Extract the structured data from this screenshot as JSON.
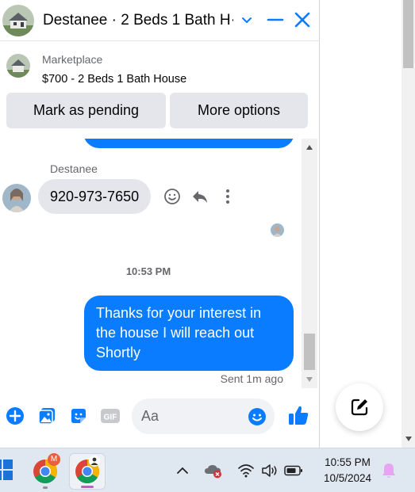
{
  "header": {
    "title": "Destanee · 2 Beds 1 Bath H···"
  },
  "marketplace": {
    "label": "Marketplace",
    "listing_title": "$700 - 2 Beds 1 Bath House",
    "mark_pending_label": "Mark as pending",
    "more_options_label": "More options"
  },
  "conversation": {
    "sender_name": "Destanee",
    "incoming_message": "920-973-7650",
    "timestamp": "10:53 PM",
    "outgoing_message": "Thanks for your interest in the house I will reach out Shortly",
    "sent_status": "Sent 1m ago"
  },
  "composer": {
    "placeholder": "Aa",
    "gif_label": "GIF"
  },
  "taskbar": {
    "gmail_badge": "M",
    "time": "10:55 PM",
    "date": "10/5/2024"
  },
  "colors": {
    "messenger_blue": "#0a7cff",
    "bubble_gray": "#e4e6eb",
    "taskbar_bg": "#dfe7f1"
  },
  "icons": {
    "header": [
      "house-avatar-icon",
      "chevron-down-icon",
      "minimize-icon",
      "close-icon"
    ],
    "message_actions": [
      "react-emoji-icon",
      "reply-icon",
      "more-vertical-icon"
    ],
    "composer": [
      "plus-circle-icon",
      "gallery-icon",
      "sticker-icon",
      "gif-icon",
      "emoji-icon",
      "thumbs-up-icon"
    ],
    "tray": [
      "chevron-up-icon",
      "onedrive-error-icon",
      "wifi-icon",
      "volume-icon",
      "battery-icon",
      "notification-bell-icon"
    ]
  }
}
